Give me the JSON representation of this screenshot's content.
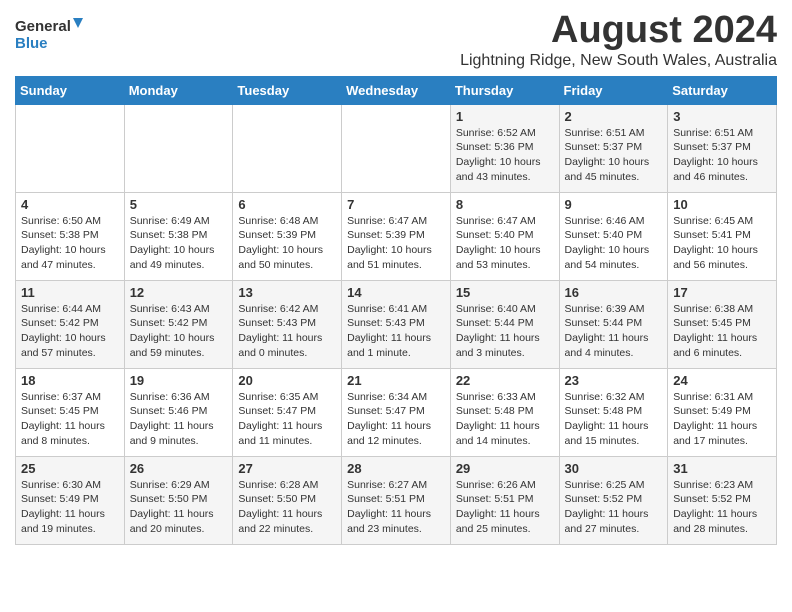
{
  "logo": {
    "line1": "General",
    "line2": "Blue"
  },
  "title": "August 2024",
  "location": "Lightning Ridge, New South Wales, Australia",
  "days_of_week": [
    "Sunday",
    "Monday",
    "Tuesday",
    "Wednesday",
    "Thursday",
    "Friday",
    "Saturday"
  ],
  "weeks": [
    [
      {
        "num": "",
        "info": ""
      },
      {
        "num": "",
        "info": ""
      },
      {
        "num": "",
        "info": ""
      },
      {
        "num": "",
        "info": ""
      },
      {
        "num": "1",
        "info": "Sunrise: 6:52 AM\nSunset: 5:36 PM\nDaylight: 10 hours\nand 43 minutes."
      },
      {
        "num": "2",
        "info": "Sunrise: 6:51 AM\nSunset: 5:37 PM\nDaylight: 10 hours\nand 45 minutes."
      },
      {
        "num": "3",
        "info": "Sunrise: 6:51 AM\nSunset: 5:37 PM\nDaylight: 10 hours\nand 46 minutes."
      }
    ],
    [
      {
        "num": "4",
        "info": "Sunrise: 6:50 AM\nSunset: 5:38 PM\nDaylight: 10 hours\nand 47 minutes."
      },
      {
        "num": "5",
        "info": "Sunrise: 6:49 AM\nSunset: 5:38 PM\nDaylight: 10 hours\nand 49 minutes."
      },
      {
        "num": "6",
        "info": "Sunrise: 6:48 AM\nSunset: 5:39 PM\nDaylight: 10 hours\nand 50 minutes."
      },
      {
        "num": "7",
        "info": "Sunrise: 6:47 AM\nSunset: 5:39 PM\nDaylight: 10 hours\nand 51 minutes."
      },
      {
        "num": "8",
        "info": "Sunrise: 6:47 AM\nSunset: 5:40 PM\nDaylight: 10 hours\nand 53 minutes."
      },
      {
        "num": "9",
        "info": "Sunrise: 6:46 AM\nSunset: 5:40 PM\nDaylight: 10 hours\nand 54 minutes."
      },
      {
        "num": "10",
        "info": "Sunrise: 6:45 AM\nSunset: 5:41 PM\nDaylight: 10 hours\nand 56 minutes."
      }
    ],
    [
      {
        "num": "11",
        "info": "Sunrise: 6:44 AM\nSunset: 5:42 PM\nDaylight: 10 hours\nand 57 minutes."
      },
      {
        "num": "12",
        "info": "Sunrise: 6:43 AM\nSunset: 5:42 PM\nDaylight: 10 hours\nand 59 minutes."
      },
      {
        "num": "13",
        "info": "Sunrise: 6:42 AM\nSunset: 5:43 PM\nDaylight: 11 hours\nand 0 minutes."
      },
      {
        "num": "14",
        "info": "Sunrise: 6:41 AM\nSunset: 5:43 PM\nDaylight: 11 hours\nand 1 minute."
      },
      {
        "num": "15",
        "info": "Sunrise: 6:40 AM\nSunset: 5:44 PM\nDaylight: 11 hours\nand 3 minutes."
      },
      {
        "num": "16",
        "info": "Sunrise: 6:39 AM\nSunset: 5:44 PM\nDaylight: 11 hours\nand 4 minutes."
      },
      {
        "num": "17",
        "info": "Sunrise: 6:38 AM\nSunset: 5:45 PM\nDaylight: 11 hours\nand 6 minutes."
      }
    ],
    [
      {
        "num": "18",
        "info": "Sunrise: 6:37 AM\nSunset: 5:45 PM\nDaylight: 11 hours\nand 8 minutes."
      },
      {
        "num": "19",
        "info": "Sunrise: 6:36 AM\nSunset: 5:46 PM\nDaylight: 11 hours\nand 9 minutes."
      },
      {
        "num": "20",
        "info": "Sunrise: 6:35 AM\nSunset: 5:47 PM\nDaylight: 11 hours\nand 11 minutes."
      },
      {
        "num": "21",
        "info": "Sunrise: 6:34 AM\nSunset: 5:47 PM\nDaylight: 11 hours\nand 12 minutes."
      },
      {
        "num": "22",
        "info": "Sunrise: 6:33 AM\nSunset: 5:48 PM\nDaylight: 11 hours\nand 14 minutes."
      },
      {
        "num": "23",
        "info": "Sunrise: 6:32 AM\nSunset: 5:48 PM\nDaylight: 11 hours\nand 15 minutes."
      },
      {
        "num": "24",
        "info": "Sunrise: 6:31 AM\nSunset: 5:49 PM\nDaylight: 11 hours\nand 17 minutes."
      }
    ],
    [
      {
        "num": "25",
        "info": "Sunrise: 6:30 AM\nSunset: 5:49 PM\nDaylight: 11 hours\nand 19 minutes."
      },
      {
        "num": "26",
        "info": "Sunrise: 6:29 AM\nSunset: 5:50 PM\nDaylight: 11 hours\nand 20 minutes."
      },
      {
        "num": "27",
        "info": "Sunrise: 6:28 AM\nSunset: 5:50 PM\nDaylight: 11 hours\nand 22 minutes."
      },
      {
        "num": "28",
        "info": "Sunrise: 6:27 AM\nSunset: 5:51 PM\nDaylight: 11 hours\nand 23 minutes."
      },
      {
        "num": "29",
        "info": "Sunrise: 6:26 AM\nSunset: 5:51 PM\nDaylight: 11 hours\nand 25 minutes."
      },
      {
        "num": "30",
        "info": "Sunrise: 6:25 AM\nSunset: 5:52 PM\nDaylight: 11 hours\nand 27 minutes."
      },
      {
        "num": "31",
        "info": "Sunrise: 6:23 AM\nSunset: 5:52 PM\nDaylight: 11 hours\nand 28 minutes."
      }
    ]
  ]
}
